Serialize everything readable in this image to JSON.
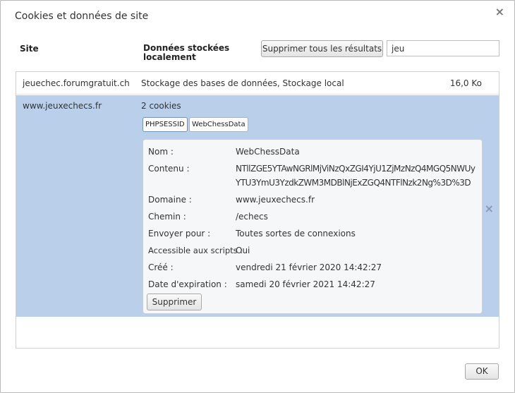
{
  "dialog": {
    "title": "Cookies et données de site",
    "close_symbol": "×"
  },
  "header": {
    "site_label": "Site",
    "data_label": "Données stockées localement",
    "delete_all_label": "Supprimer tous les résultats",
    "search_value": "jeu"
  },
  "rows": [
    {
      "site": "jeuechec.forumgratuit.ch",
      "data": "Stockage des bases de données, Stockage local",
      "size": "16,0 Ko"
    },
    {
      "site": "www.jeuxechecs.fr",
      "count": "2 cookies",
      "cookies": [
        "PHPSESSID",
        "WebChessData"
      ],
      "selected_cookie": "WebChessData",
      "remove_symbol": "×"
    }
  ],
  "details": {
    "name_label": "Nom :",
    "name_value": "WebChessData",
    "content_label": "Contenu :",
    "content_value": "NTllZGE5YTAwNGRlMjViNzQxZGI4YjU1ZjMzNzQ4MGQ5NWUyYTU3YmU3YzdkZWM3MDBlNjExZGQ4NTFlNzk2Ng%3D%3D",
    "domain_label": "Domaine :",
    "domain_value": "www.jeuxechecs.fr",
    "path_label": "Chemin :",
    "path_value": "/echecs",
    "send_for_label": "Envoyer pour :",
    "send_for_value": "Toutes sortes de connexions",
    "script_label": "Accessible aux scripts :",
    "script_value": "Oui",
    "created_label": "Créé :",
    "created_value": "vendredi 21 février 2020 14:42:27",
    "expires_label": "Date d'expiration :",
    "expires_value": "samedi 20 février 2021 14:42:27",
    "delete_label": "Supprimer"
  },
  "footer": {
    "ok_label": "OK"
  }
}
